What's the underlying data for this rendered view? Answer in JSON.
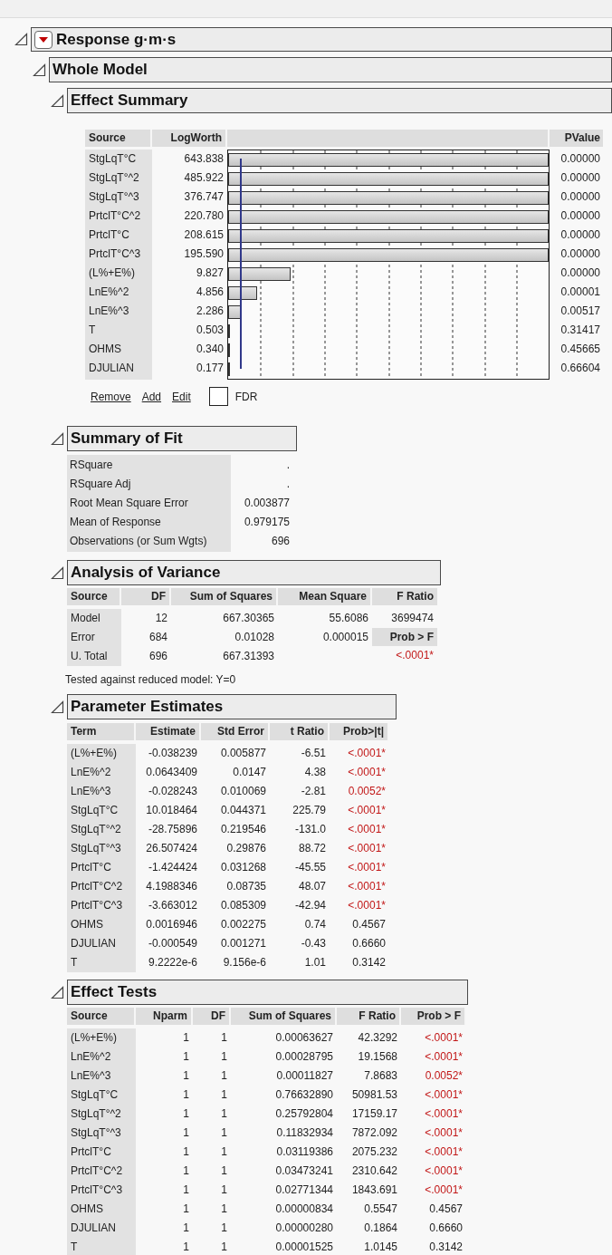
{
  "report": {
    "title": "Response g·m·s"
  },
  "whole_model": {
    "title": "Whole Model"
  },
  "effect_summary": {
    "title": "Effect Summary",
    "columns": [
      "Source",
      "LogWorth",
      "PValue"
    ],
    "rows": [
      {
        "source": "StgLqT°C",
        "logworth": "643.838",
        "level": 1,
        "pvalue": "0.00000"
      },
      {
        "source": "StgLqT°^2",
        "logworth": "485.922",
        "level": 1,
        "pvalue": "0.00000"
      },
      {
        "source": "StgLqT°^3",
        "logworth": "376.747",
        "level": 1,
        "pvalue": "0.00000"
      },
      {
        "source": "PrtclT°C^2",
        "logworth": "220.780",
        "level": 1,
        "pvalue": "0.00000"
      },
      {
        "source": "PrtclT°C",
        "logworth": "208.615",
        "level": 1,
        "pvalue": "0.00000"
      },
      {
        "source": "PrtclT°C^3",
        "logworth": "195.590",
        "level": 1,
        "pvalue": "0.00000"
      },
      {
        "source": "(L%+E%)",
        "logworth": "9.827",
        "level": 0.195,
        "pvalue": "0.00000"
      },
      {
        "source": "LnE%^2",
        "logworth": "4.856",
        "level": 0.09,
        "pvalue": "0.00001"
      },
      {
        "source": "LnE%^3",
        "logworth": "2.286",
        "level": 0.042,
        "pvalue": "0.00517"
      },
      {
        "source": "T",
        "logworth": "0.503",
        "level": 0.007,
        "pvalue": "0.31417"
      },
      {
        "source": "OHMS",
        "logworth": "0.340",
        "level": 0.004,
        "pvalue": "0.45665"
      },
      {
        "source": "DJULIAN",
        "logworth": "0.177",
        "level": 0.002,
        "pvalue": "0.66604"
      }
    ],
    "links": [
      "Remove",
      "Add",
      "Edit"
    ],
    "fdr": {
      "label": "FDR",
      "checked": false
    }
  },
  "summary_of_fit": {
    "title": "Summary of Fit",
    "rows": [
      {
        "label": "RSquare",
        "value": "."
      },
      {
        "label": "RSquare Adj",
        "value": "."
      },
      {
        "label": "Root Mean Square Error",
        "value": "0.003877"
      },
      {
        "label": "Mean of Response",
        "value": "0.979175"
      },
      {
        "label": "Observations (or Sum Wgts)",
        "value": "696"
      }
    ]
  },
  "analysis_of_variance": {
    "title": "Analysis of Variance",
    "columns": [
      "Source",
      "DF",
      "Sum of Squares",
      "Mean Square",
      "F Ratio"
    ],
    "rows": [
      {
        "source": "Model",
        "df": "12",
        "sum_of_squares": "667.30365",
        "mean_square": "55.6086"
      },
      {
        "source": "Error",
        "df": "684",
        "sum_of_squares": "0.01028",
        "mean_square": "0.000015"
      },
      {
        "source": "U. Total",
        "df": "696",
        "sum_of_squares": "667.31393"
      }
    ],
    "f_ratio": "3699474",
    "prob_label": "Prob > F",
    "prob": "<.0001*",
    "significant": true,
    "note": "Tested against reduced model: Y=0"
  },
  "parameter_estimates": {
    "title": "Parameter Estimates",
    "columns": [
      "Term",
      "Estimate",
      "Std Error",
      "t Ratio",
      "Prob>|t|"
    ],
    "rows": [
      {
        "term": "(L%+E%)",
        "estimate": "-0.038239",
        "std_error": "0.005877",
        "t_ratio": "-6.51",
        "prob": "<.0001*",
        "significant": true
      },
      {
        "term": "LnE%^2",
        "estimate": "0.0643409",
        "std_error": "0.0147",
        "t_ratio": "4.38",
        "prob": "<.0001*",
        "significant": true
      },
      {
        "term": "LnE%^3",
        "estimate": "-0.028243",
        "std_error": "0.010069",
        "t_ratio": "-2.81",
        "prob": "0.0052*",
        "significant": true
      },
      {
        "term": "StgLqT°C",
        "estimate": "10.018464",
        "std_error": "0.044371",
        "t_ratio": "225.79",
        "prob": "<.0001*",
        "significant": true
      },
      {
        "term": "StgLqT°^2",
        "estimate": "-28.75896",
        "std_error": "0.219546",
        "t_ratio": "-131.0",
        "prob": "<.0001*",
        "significant": true
      },
      {
        "term": "StgLqT°^3",
        "estimate": "26.507424",
        "std_error": "0.29876",
        "t_ratio": "88.72",
        "prob": "<.0001*",
        "significant": true
      },
      {
        "term": "PrtclT°C",
        "estimate": "-1.424424",
        "std_error": "0.031268",
        "t_ratio": "-45.55",
        "prob": "<.0001*",
        "significant": true
      },
      {
        "term": "PrtclT°C^2",
        "estimate": "4.1988346",
        "std_error": "0.08735",
        "t_ratio": "48.07",
        "prob": "<.0001*",
        "significant": true
      },
      {
        "term": "PrtclT°C^3",
        "estimate": "-3.663012",
        "std_error": "0.085309",
        "t_ratio": "-42.94",
        "prob": "<.0001*",
        "significant": true
      },
      {
        "term": "OHMS",
        "estimate": "0.0016946",
        "std_error": "0.002275",
        "t_ratio": "0.74",
        "prob": "0.4567",
        "significant": false
      },
      {
        "term": "DJULIAN",
        "estimate": "-0.000549",
        "std_error": "0.001271",
        "t_ratio": "-0.43",
        "prob": "0.6660",
        "significant": false
      },
      {
        "term": "T",
        "estimate": "9.2222e-6",
        "std_error": "9.156e-6",
        "t_ratio": "1.01",
        "prob": "0.3142",
        "significant": false
      }
    ]
  },
  "effect_tests": {
    "title": "Effect Tests",
    "columns": [
      "Source",
      "Nparm",
      "DF",
      "Sum of Squares",
      "F Ratio",
      "Prob > F"
    ],
    "rows": [
      {
        "source": "(L%+E%)",
        "nparm": "1",
        "df": "1",
        "sum_of_squares": "0.00063627",
        "f_ratio": "42.3292",
        "prob": "<.0001*",
        "significant": true
      },
      {
        "source": "LnE%^2",
        "nparm": "1",
        "df": "1",
        "sum_of_squares": "0.00028795",
        "f_ratio": "19.1568",
        "prob": "<.0001*",
        "significant": true
      },
      {
        "source": "LnE%^3",
        "nparm": "1",
        "df": "1",
        "sum_of_squares": "0.00011827",
        "f_ratio": "7.8683",
        "prob": "0.0052*",
        "significant": true
      },
      {
        "source": "StgLqT°C",
        "nparm": "1",
        "df": "1",
        "sum_of_squares": "0.76632890",
        "f_ratio": "50981.53",
        "prob": "<.0001*",
        "significant": true
      },
      {
        "source": "StgLqT°^2",
        "nparm": "1",
        "df": "1",
        "sum_of_squares": "0.25792804",
        "f_ratio": "17159.17",
        "prob": "<.0001*",
        "significant": true
      },
      {
        "source": "StgLqT°^3",
        "nparm": "1",
        "df": "1",
        "sum_of_squares": "0.11832934",
        "f_ratio": "7872.092",
        "prob": "<.0001*",
        "significant": true
      },
      {
        "source": "PrtclT°C",
        "nparm": "1",
        "df": "1",
        "sum_of_squares": "0.03119386",
        "f_ratio": "2075.232",
        "prob": "<.0001*",
        "significant": true
      },
      {
        "source": "PrtclT°C^2",
        "nparm": "1",
        "df": "1",
        "sum_of_squares": "0.03473241",
        "f_ratio": "2310.642",
        "prob": "<.0001*",
        "significant": true
      },
      {
        "source": "PrtclT°C^3",
        "nparm": "1",
        "df": "1",
        "sum_of_squares": "0.02771344",
        "f_ratio": "1843.691",
        "prob": "<.0001*",
        "significant": true
      },
      {
        "source": "OHMS",
        "nparm": "1",
        "df": "1",
        "sum_of_squares": "0.00000834",
        "f_ratio": "0.5547",
        "prob": "0.4567",
        "significant": false
      },
      {
        "source": "DJULIAN",
        "nparm": "1",
        "df": "1",
        "sum_of_squares": "0.00000280",
        "f_ratio": "0.1864",
        "prob": "0.6660",
        "significant": false
      },
      {
        "source": "T",
        "nparm": "1",
        "df": "1",
        "sum_of_squares": "0.00001525",
        "f_ratio": "1.0145",
        "prob": "0.3142",
        "significant": false
      }
    ]
  }
}
